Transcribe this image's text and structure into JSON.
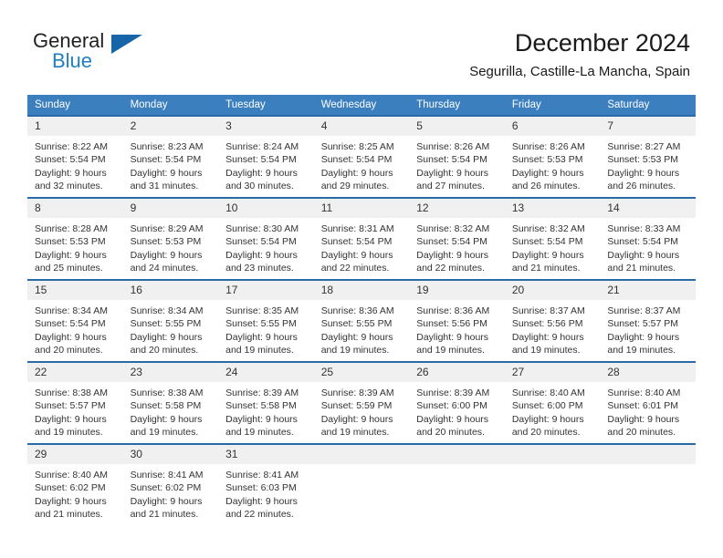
{
  "brand": {
    "name_top": "General",
    "name_bottom": "Blue",
    "triangle_color": "#1565a8",
    "blue_color": "#1f7fc4"
  },
  "header": {
    "title": "December 2024",
    "subtitle": "Segurilla, Castille-La Mancha, Spain"
  },
  "colors": {
    "header_row": "#3c7fbf",
    "row_border": "#2a6aa8",
    "daynum_band": "#f0f0f0",
    "text": "#333333"
  },
  "weekdays": [
    "Sunday",
    "Monday",
    "Tuesday",
    "Wednesday",
    "Thursday",
    "Friday",
    "Saturday"
  ],
  "weeks": [
    [
      {
        "day": "1",
        "sunrise": "Sunrise: 8:22 AM",
        "sunset": "Sunset: 5:54 PM",
        "daylight1": "Daylight: 9 hours",
        "daylight2": "and 32 minutes."
      },
      {
        "day": "2",
        "sunrise": "Sunrise: 8:23 AM",
        "sunset": "Sunset: 5:54 PM",
        "daylight1": "Daylight: 9 hours",
        "daylight2": "and 31 minutes."
      },
      {
        "day": "3",
        "sunrise": "Sunrise: 8:24 AM",
        "sunset": "Sunset: 5:54 PM",
        "daylight1": "Daylight: 9 hours",
        "daylight2": "and 30 minutes."
      },
      {
        "day": "4",
        "sunrise": "Sunrise: 8:25 AM",
        "sunset": "Sunset: 5:54 PM",
        "daylight1": "Daylight: 9 hours",
        "daylight2": "and 29 minutes."
      },
      {
        "day": "5",
        "sunrise": "Sunrise: 8:26 AM",
        "sunset": "Sunset: 5:54 PM",
        "daylight1": "Daylight: 9 hours",
        "daylight2": "and 27 minutes."
      },
      {
        "day": "6",
        "sunrise": "Sunrise: 8:26 AM",
        "sunset": "Sunset: 5:53 PM",
        "daylight1": "Daylight: 9 hours",
        "daylight2": "and 26 minutes."
      },
      {
        "day": "7",
        "sunrise": "Sunrise: 8:27 AM",
        "sunset": "Sunset: 5:53 PM",
        "daylight1": "Daylight: 9 hours",
        "daylight2": "and 26 minutes."
      }
    ],
    [
      {
        "day": "8",
        "sunrise": "Sunrise: 8:28 AM",
        "sunset": "Sunset: 5:53 PM",
        "daylight1": "Daylight: 9 hours",
        "daylight2": "and 25 minutes."
      },
      {
        "day": "9",
        "sunrise": "Sunrise: 8:29 AM",
        "sunset": "Sunset: 5:53 PM",
        "daylight1": "Daylight: 9 hours",
        "daylight2": "and 24 minutes."
      },
      {
        "day": "10",
        "sunrise": "Sunrise: 8:30 AM",
        "sunset": "Sunset: 5:54 PM",
        "daylight1": "Daylight: 9 hours",
        "daylight2": "and 23 minutes."
      },
      {
        "day": "11",
        "sunrise": "Sunrise: 8:31 AM",
        "sunset": "Sunset: 5:54 PM",
        "daylight1": "Daylight: 9 hours",
        "daylight2": "and 22 minutes."
      },
      {
        "day": "12",
        "sunrise": "Sunrise: 8:32 AM",
        "sunset": "Sunset: 5:54 PM",
        "daylight1": "Daylight: 9 hours",
        "daylight2": "and 22 minutes."
      },
      {
        "day": "13",
        "sunrise": "Sunrise: 8:32 AM",
        "sunset": "Sunset: 5:54 PM",
        "daylight1": "Daylight: 9 hours",
        "daylight2": "and 21 minutes."
      },
      {
        "day": "14",
        "sunrise": "Sunrise: 8:33 AM",
        "sunset": "Sunset: 5:54 PM",
        "daylight1": "Daylight: 9 hours",
        "daylight2": "and 21 minutes."
      }
    ],
    [
      {
        "day": "15",
        "sunrise": "Sunrise: 8:34 AM",
        "sunset": "Sunset: 5:54 PM",
        "daylight1": "Daylight: 9 hours",
        "daylight2": "and 20 minutes."
      },
      {
        "day": "16",
        "sunrise": "Sunrise: 8:34 AM",
        "sunset": "Sunset: 5:55 PM",
        "daylight1": "Daylight: 9 hours",
        "daylight2": "and 20 minutes."
      },
      {
        "day": "17",
        "sunrise": "Sunrise: 8:35 AM",
        "sunset": "Sunset: 5:55 PM",
        "daylight1": "Daylight: 9 hours",
        "daylight2": "and 19 minutes."
      },
      {
        "day": "18",
        "sunrise": "Sunrise: 8:36 AM",
        "sunset": "Sunset: 5:55 PM",
        "daylight1": "Daylight: 9 hours",
        "daylight2": "and 19 minutes."
      },
      {
        "day": "19",
        "sunrise": "Sunrise: 8:36 AM",
        "sunset": "Sunset: 5:56 PM",
        "daylight1": "Daylight: 9 hours",
        "daylight2": "and 19 minutes."
      },
      {
        "day": "20",
        "sunrise": "Sunrise: 8:37 AM",
        "sunset": "Sunset: 5:56 PM",
        "daylight1": "Daylight: 9 hours",
        "daylight2": "and 19 minutes."
      },
      {
        "day": "21",
        "sunrise": "Sunrise: 8:37 AM",
        "sunset": "Sunset: 5:57 PM",
        "daylight1": "Daylight: 9 hours",
        "daylight2": "and 19 minutes."
      }
    ],
    [
      {
        "day": "22",
        "sunrise": "Sunrise: 8:38 AM",
        "sunset": "Sunset: 5:57 PM",
        "daylight1": "Daylight: 9 hours",
        "daylight2": "and 19 minutes."
      },
      {
        "day": "23",
        "sunrise": "Sunrise: 8:38 AM",
        "sunset": "Sunset: 5:58 PM",
        "daylight1": "Daylight: 9 hours",
        "daylight2": "and 19 minutes."
      },
      {
        "day": "24",
        "sunrise": "Sunrise: 8:39 AM",
        "sunset": "Sunset: 5:58 PM",
        "daylight1": "Daylight: 9 hours",
        "daylight2": "and 19 minutes."
      },
      {
        "day": "25",
        "sunrise": "Sunrise: 8:39 AM",
        "sunset": "Sunset: 5:59 PM",
        "daylight1": "Daylight: 9 hours",
        "daylight2": "and 19 minutes."
      },
      {
        "day": "26",
        "sunrise": "Sunrise: 8:39 AM",
        "sunset": "Sunset: 6:00 PM",
        "daylight1": "Daylight: 9 hours",
        "daylight2": "and 20 minutes."
      },
      {
        "day": "27",
        "sunrise": "Sunrise: 8:40 AM",
        "sunset": "Sunset: 6:00 PM",
        "daylight1": "Daylight: 9 hours",
        "daylight2": "and 20 minutes."
      },
      {
        "day": "28",
        "sunrise": "Sunrise: 8:40 AM",
        "sunset": "Sunset: 6:01 PM",
        "daylight1": "Daylight: 9 hours",
        "daylight2": "and 20 minutes."
      }
    ],
    [
      {
        "day": "29",
        "sunrise": "Sunrise: 8:40 AM",
        "sunset": "Sunset: 6:02 PM",
        "daylight1": "Daylight: 9 hours",
        "daylight2": "and 21 minutes."
      },
      {
        "day": "30",
        "sunrise": "Sunrise: 8:41 AM",
        "sunset": "Sunset: 6:02 PM",
        "daylight1": "Daylight: 9 hours",
        "daylight2": "and 21 minutes."
      },
      {
        "day": "31",
        "sunrise": "Sunrise: 8:41 AM",
        "sunset": "Sunset: 6:03 PM",
        "daylight1": "Daylight: 9 hours",
        "daylight2": "and 22 minutes."
      },
      {
        "day": "",
        "sunrise": "",
        "sunset": "",
        "daylight1": "",
        "daylight2": ""
      },
      {
        "day": "",
        "sunrise": "",
        "sunset": "",
        "daylight1": "",
        "daylight2": ""
      },
      {
        "day": "",
        "sunrise": "",
        "sunset": "",
        "daylight1": "",
        "daylight2": ""
      },
      {
        "day": "",
        "sunrise": "",
        "sunset": "",
        "daylight1": "",
        "daylight2": ""
      }
    ]
  ]
}
